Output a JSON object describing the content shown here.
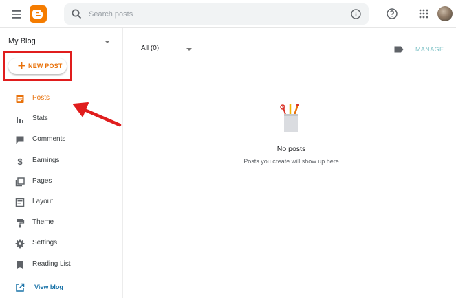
{
  "header": {
    "search": {
      "placeholder": "Search posts",
      "value": ""
    }
  },
  "sidebar": {
    "blog_name": "My Blog",
    "new_post_label": "NEW POST",
    "items": [
      {
        "label": "Posts",
        "icon": "posts-icon",
        "active": true
      },
      {
        "label": "Stats",
        "icon": "stats-icon",
        "active": false
      },
      {
        "label": "Comments",
        "icon": "comments-icon",
        "active": false
      },
      {
        "label": "Earnings",
        "icon": "dollar-icon",
        "active": false
      },
      {
        "label": "Pages",
        "icon": "pages-icon",
        "active": false
      },
      {
        "label": "Layout",
        "icon": "layout-icon",
        "active": false
      },
      {
        "label": "Theme",
        "icon": "paint-roller-icon",
        "active": false
      },
      {
        "label": "Settings",
        "icon": "gear-icon",
        "active": false
      },
      {
        "label": "Reading List",
        "icon": "bookmark-icon",
        "active": false
      }
    ],
    "view_blog_label": "View blog"
  },
  "main": {
    "filter_label": "All (0)",
    "manage_label": "MANAGE",
    "empty": {
      "title": "No posts",
      "subtitle": "Posts you create will show up here"
    }
  },
  "colors": {
    "accent": "#e8710a",
    "brand": "#f57c00",
    "highlight": "#e01d1d",
    "link": "#1a73a8",
    "manage": "#82c4c8"
  }
}
